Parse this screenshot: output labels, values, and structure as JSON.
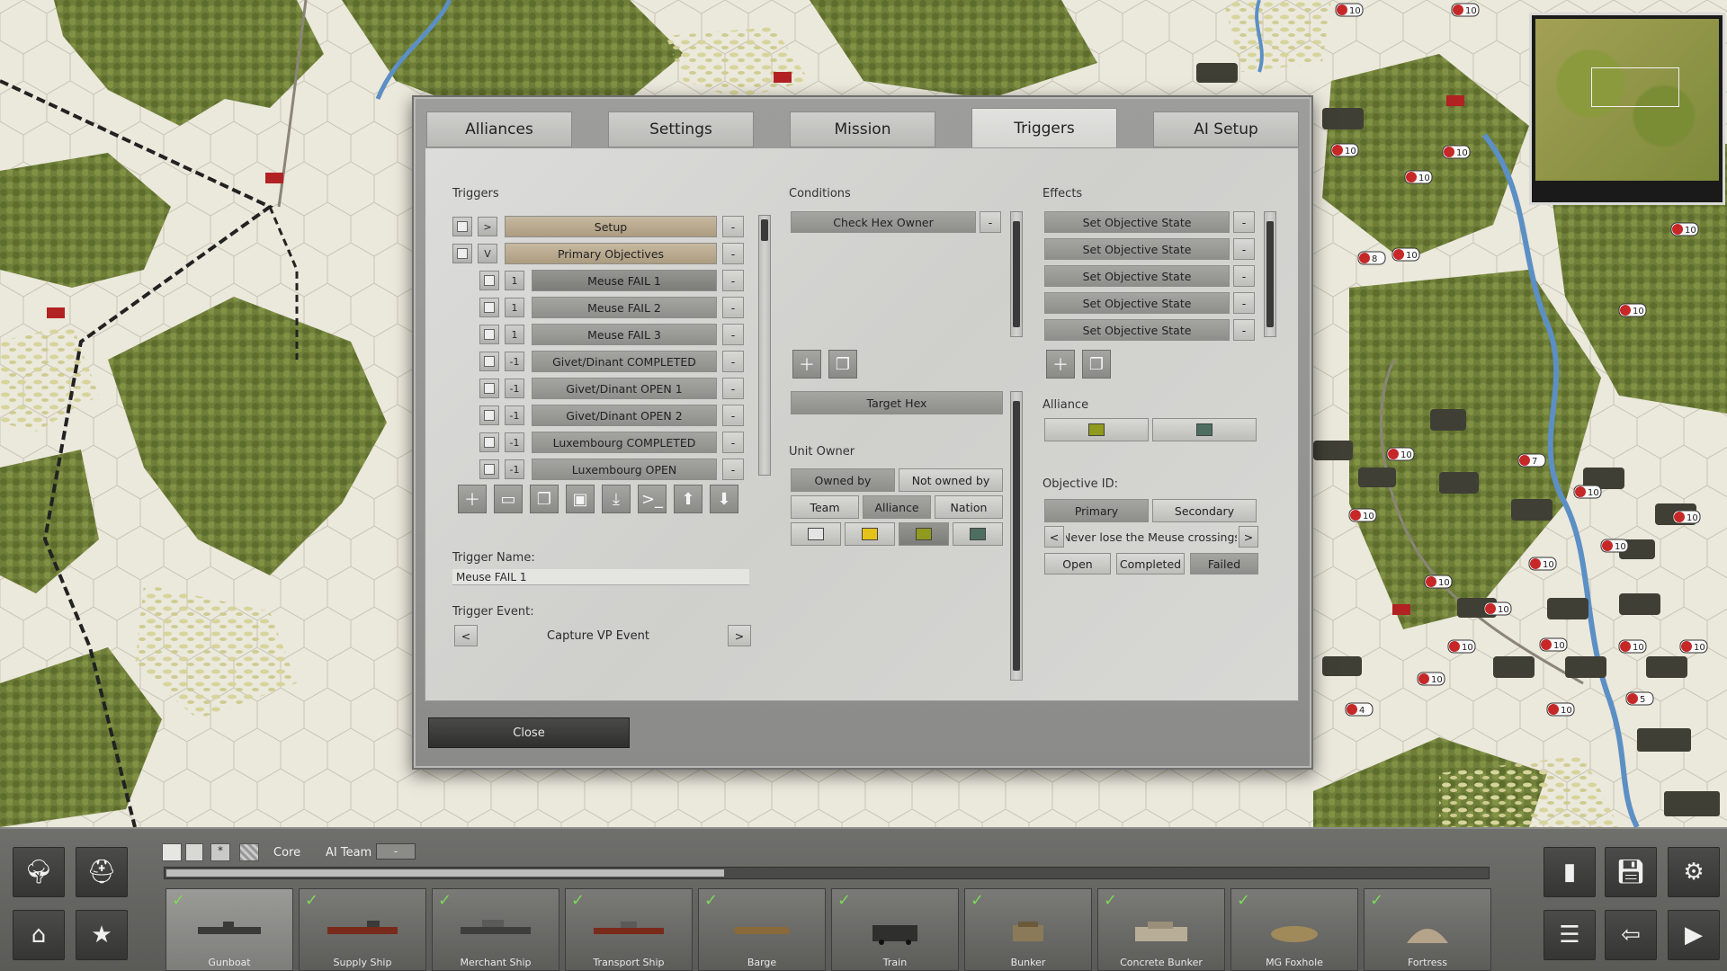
{
  "tabs": [
    "Alliances",
    "Settings",
    "Mission",
    "Triggers",
    "AI Setup"
  ],
  "active_tab": "Triggers",
  "triggers_panel": {
    "label": "Triggers",
    "items": [
      {
        "expander": ">",
        "name": "Setup",
        "remove": "-"
      },
      {
        "expander": "V",
        "name": "Primary Objectives",
        "remove": "-"
      },
      {
        "prio": "1",
        "name": "Meuse FAIL 1",
        "remove": "-"
      },
      {
        "prio": "1",
        "name": "Meuse FAIL 2",
        "remove": "-"
      },
      {
        "prio": "1",
        "name": "Meuse FAIL 3",
        "remove": "-"
      },
      {
        "prio": "-1",
        "name": "Givet/Dinant COMPLETED",
        "remove": "-"
      },
      {
        "prio": "-1",
        "name": "Givet/Dinant OPEN 1",
        "remove": "-"
      },
      {
        "prio": "-1",
        "name": "Givet/Dinant OPEN 2",
        "remove": "-"
      },
      {
        "prio": "-1",
        "name": "Luxembourg COMPLETED",
        "remove": "-"
      },
      {
        "prio": "-1",
        "name": "Luxembourg OPEN",
        "remove": "-"
      }
    ],
    "tools": [
      "add-icon",
      "folder-icon",
      "copy-icon",
      "save-icon",
      "import-icon",
      "terminal-icon",
      "move-up-icon",
      "move-down-icon"
    ],
    "trigger_name_label": "Trigger Name:",
    "trigger_name_value": "Meuse FAIL 1",
    "trigger_event_label": "Trigger Event:",
    "trigger_event_value": "Capture VP Event",
    "prev": "<",
    "next": ">"
  },
  "conditions_panel": {
    "label": "Conditions",
    "items": [
      {
        "name": "Check Hex Owner",
        "remove": "-"
      }
    ],
    "target_hex": "Target Hex",
    "unit_owner_label": "Unit Owner",
    "owned_by": "Owned by",
    "not_owned_by": "Not owned by",
    "team": "Team",
    "alliance": "Alliance",
    "nation": "Nation",
    "swatches": [
      "#e4e4e4",
      "#e5c21a",
      "#8f9a1e",
      "#4e6e60"
    ]
  },
  "effects_panel": {
    "label": "Effects",
    "items": [
      {
        "name": "Set Objective State",
        "remove": "-"
      },
      {
        "name": "Set Objective State",
        "remove": "-"
      },
      {
        "name": "Set Objective State",
        "remove": "-"
      },
      {
        "name": "Set Objective State",
        "remove": "-"
      },
      {
        "name": "Set Objective State",
        "remove": "-"
      }
    ],
    "alliance_label": "Alliance",
    "alliance_swatches": [
      "#8f9a1e",
      "#4e6e60"
    ],
    "objective_id_label": "Objective ID:",
    "primary": "Primary",
    "secondary": "Secondary",
    "objective_name": "Never lose the Meuse crossings",
    "prev": "<",
    "next": ">",
    "open": "Open",
    "completed": "Completed",
    "failed": "Failed"
  },
  "close_label": "Close",
  "bottom_bar": {
    "core_label": "Core",
    "ai_team_label": "AI Team",
    "ai_team_value": "-",
    "units": [
      "Gunboat",
      "Supply Ship",
      "Merchant Ship",
      "Transport Ship",
      "Barge",
      "Train",
      "Bunker",
      "Concrete Bunker",
      "MG Foxhole",
      "Fortress"
    ]
  },
  "map_badges": [
    "10",
    "10",
    "10",
    "10",
    "10",
    "10",
    "10",
    "10",
    "10",
    "7",
    "10",
    "10",
    "10",
    "10",
    "10",
    "10",
    "10",
    "10",
    "10",
    "10",
    "10",
    "10",
    "10",
    "5",
    "4",
    "10",
    "8"
  ]
}
